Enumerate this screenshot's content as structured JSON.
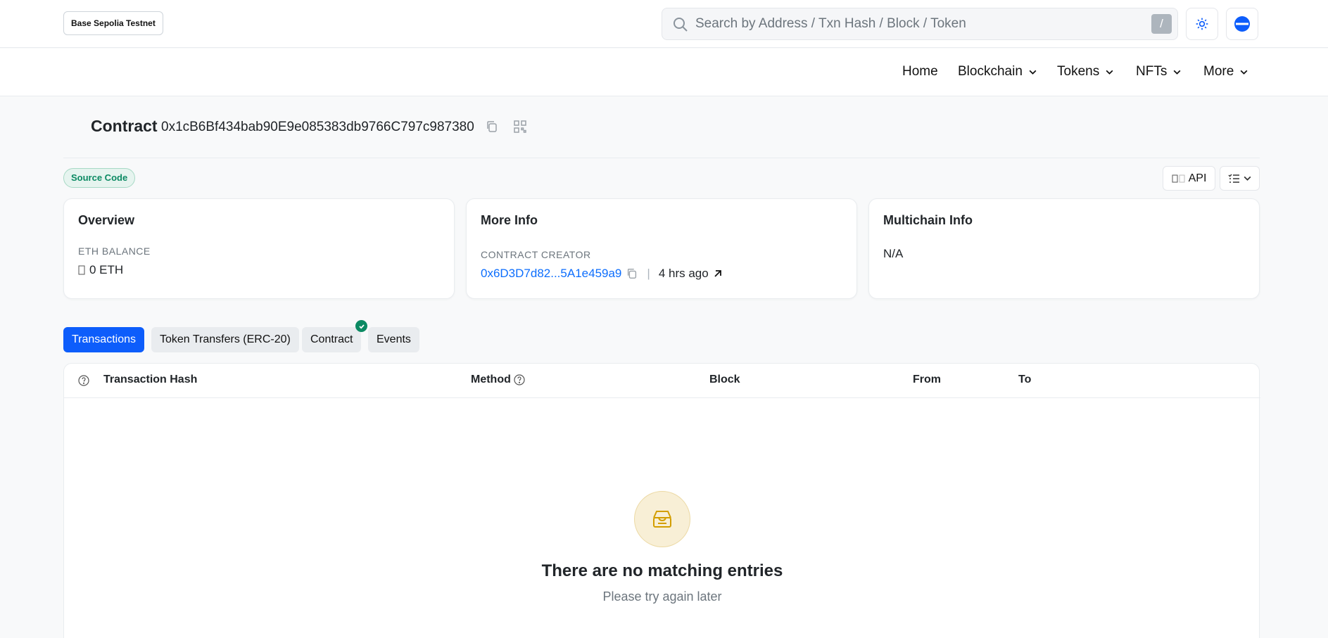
{
  "header": {
    "network": "Base Sepolia Testnet",
    "search_placeholder": "Search by Address / Txn Hash / Block / Token",
    "search_shortcut": "/"
  },
  "nav": {
    "home": "Home",
    "blockchain": "Blockchain",
    "tokens": "Tokens",
    "nfts": "NFTs",
    "more": "More"
  },
  "page": {
    "title": "Contract",
    "address": "0x1cB6Bf434bab90E9e085383db9766C797c987380",
    "source_badge": "Source Code",
    "api_label": "API"
  },
  "overview": {
    "title": "Overview",
    "balance_label": "ETH BALANCE",
    "balance_value": "0 ETH"
  },
  "more_info": {
    "title": "More Info",
    "creator_label": "CONTRACT CREATOR",
    "creator_address": "0x6D3D7d82...5A1e459a9",
    "separator": "|",
    "creator_time": "4 hrs ago"
  },
  "multichain": {
    "title": "Multichain Info",
    "value": "N/A"
  },
  "tabs": [
    "Transactions",
    "Token Transfers (ERC-20)",
    "Contract",
    "Events"
  ],
  "table": {
    "columns": [
      "Transaction Hash",
      "Method",
      "Block",
      "From",
      "To"
    ],
    "empty_title": "There are no matching entries",
    "empty_subtitle": "Please try again later"
  },
  "colors": {
    "accent": "#0d5dfb",
    "success": "#0c8a63",
    "link": "#0d6efd"
  }
}
